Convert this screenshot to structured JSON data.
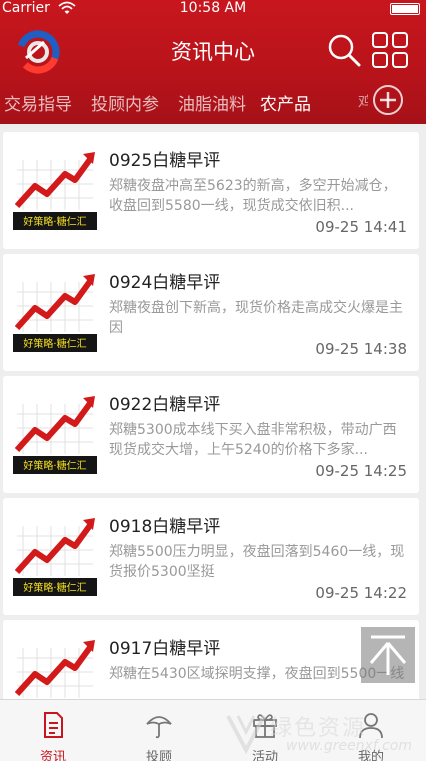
{
  "status": {
    "carrier": "Carrier",
    "time": "10:58 AM"
  },
  "nav": {
    "title": "资讯中心"
  },
  "tabs": [
    {
      "label": "交易指导"
    },
    {
      "label": "投顾内参"
    },
    {
      "label": "油脂油料"
    },
    {
      "label": "农产品"
    }
  ],
  "tab_overflow": "鸡",
  "articles": [
    {
      "title": "0925白糖早评",
      "summary": "郑糖夜盘冲高至5623的新高，多空开始减仓，收盘回到5580一线，现货成交依旧积...",
      "time": "09-25 14:41"
    },
    {
      "title": "0924白糖早评",
      "summary": "郑糖夜盘创下新高，现货价格走高成交火爆是主因",
      "time": "09-25 14:38"
    },
    {
      "title": "0922白糖早评",
      "summary": "郑糖5300成本线下买入盘非常积极，带动广西现货成交大增，上午5240的价格下多家...",
      "time": "09-25 14:25"
    },
    {
      "title": "0918白糖早评",
      "summary": "郑糖5500压力明显，夜盘回落到5460一线，现货报价5300坚挺",
      "time": "09-25 14:22"
    },
    {
      "title": "0917白糖早评",
      "summary": "郑糖在5430区域探明支撑，夜盘回到5500一线",
      "time": ""
    }
  ],
  "thumb_caption": "好策略·糖仁汇",
  "tabbar": [
    {
      "label": "资讯",
      "icon": "document-icon"
    },
    {
      "label": "投顾",
      "icon": "umbrella-icon"
    },
    {
      "label": "活动",
      "icon": "gift-icon"
    },
    {
      "label": "我的",
      "icon": "person-icon"
    }
  ],
  "watermark": {
    "text": "绿色资源",
    "url": "www.greenxf.com"
  },
  "colors": {
    "brand_red": "#c8161e",
    "active_tab": "#c8161e"
  }
}
